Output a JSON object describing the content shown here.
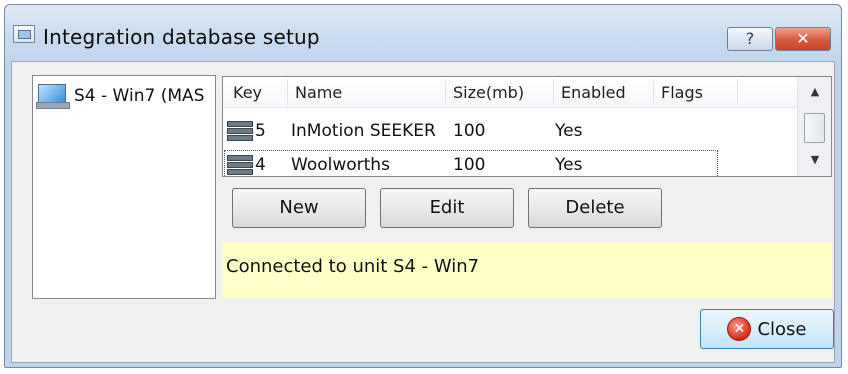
{
  "window": {
    "title": "Integration database setup",
    "help_button": "?",
    "close_button": "✕"
  },
  "units": {
    "items": [
      {
        "label": "S4 - Win7 (MAS"
      }
    ]
  },
  "db_list": {
    "columns": [
      "Key",
      "Name",
      "Size(mb)",
      "Enabled",
      "Flags"
    ],
    "rows": [
      {
        "key": "5",
        "name": "InMotion SEEKER",
        "size": "100",
        "enabled": "Yes",
        "flags": ""
      },
      {
        "key": "4",
        "name": "Woolworths",
        "size": "100",
        "enabled": "Yes",
        "flags": ""
      }
    ]
  },
  "buttons": {
    "new": "New",
    "edit": "Edit",
    "delete": "Delete",
    "close": "Close"
  },
  "status": {
    "text": "Connected to unit S4 - Win7"
  },
  "colors": {
    "status_bg": "#ffffc8",
    "close_button_accent": "#d65a3d"
  }
}
